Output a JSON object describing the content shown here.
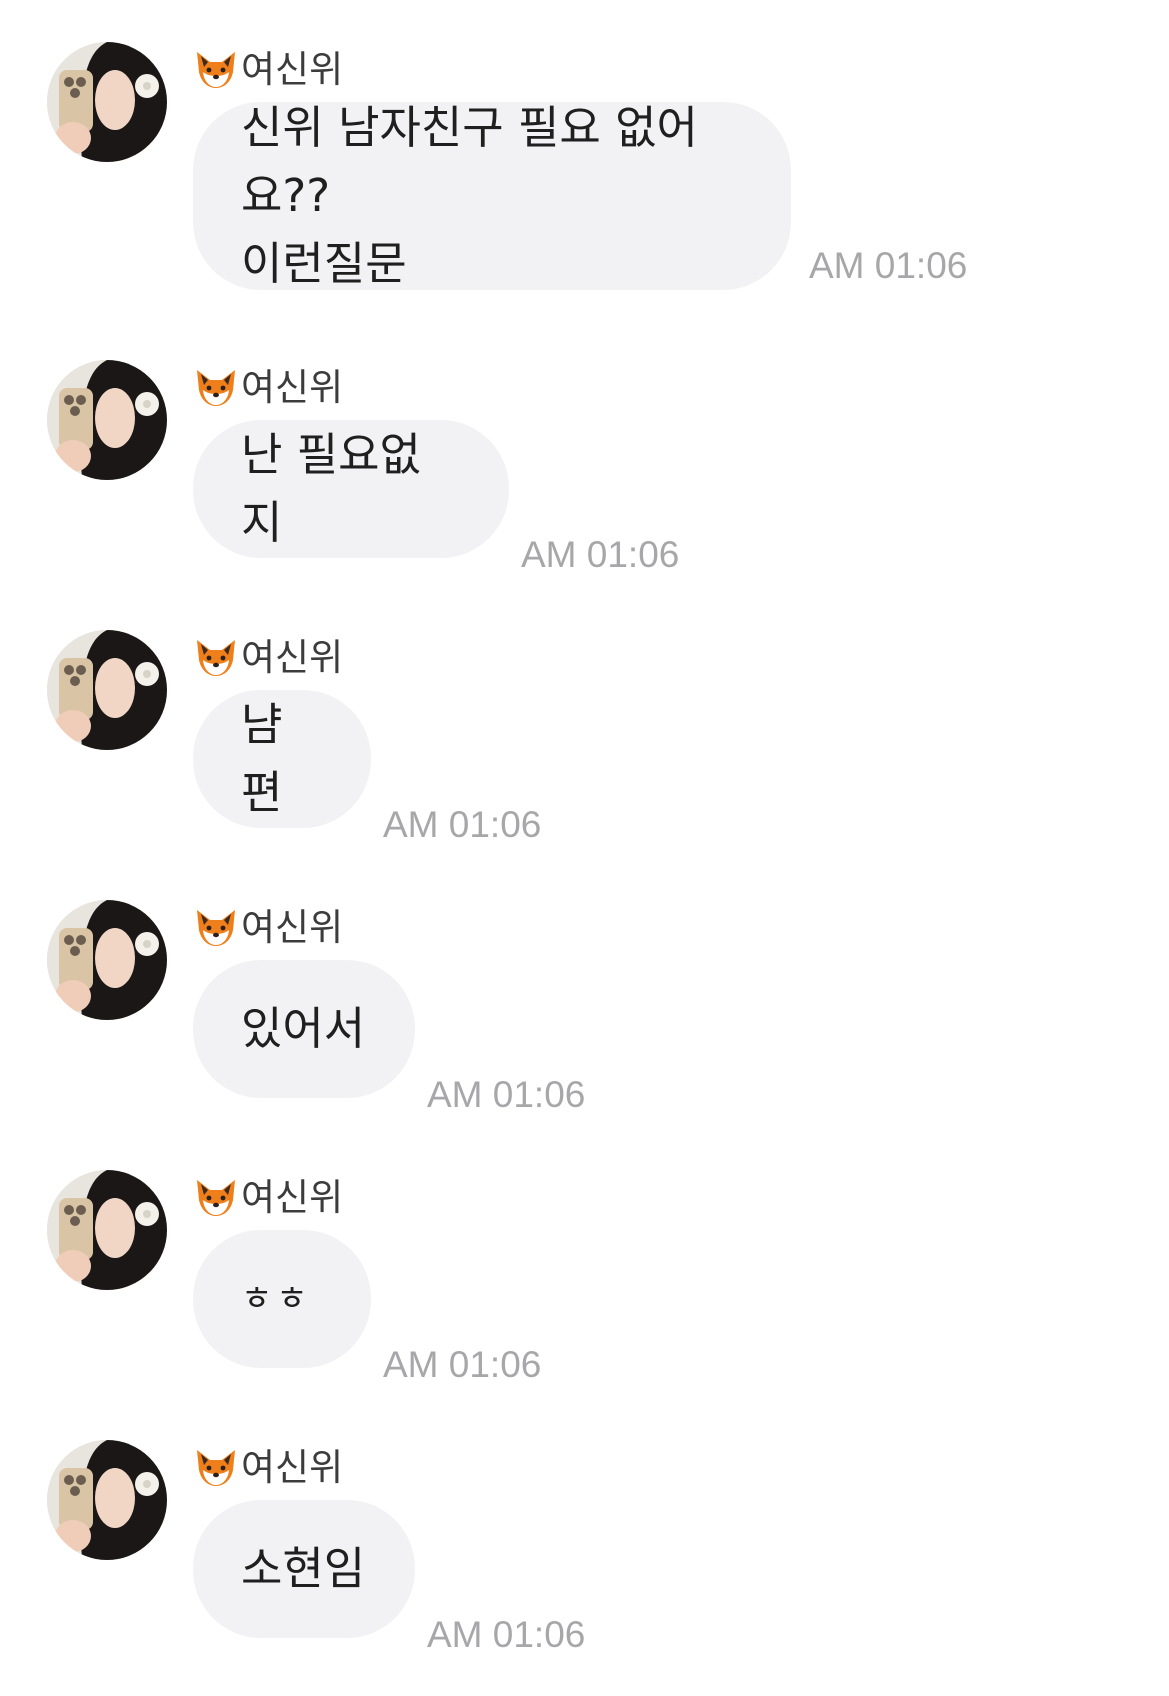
{
  "theme": {
    "bubble_color": "#f2f2f4",
    "text_color": "#1f1f1f",
    "time_color": "#a7a7aa"
  },
  "messages": [
    {
      "sender_icon": "fox-face-icon",
      "sender_name": "여신위",
      "text": "신위 남자친구 필요 없어요??\n이런질문",
      "time": "AM 01:06"
    },
    {
      "sender_icon": "fox-face-icon",
      "sender_name": "여신위",
      "text": "난 필요없지",
      "time": "AM 01:06"
    },
    {
      "sender_icon": "fox-face-icon",
      "sender_name": "여신위",
      "text": "냠편",
      "time": "AM 01:06"
    },
    {
      "sender_icon": "fox-face-icon",
      "sender_name": "여신위",
      "text": "있어서",
      "time": "AM 01:06"
    },
    {
      "sender_icon": "fox-face-icon",
      "sender_name": "여신위",
      "text": "ㅎㅎ",
      "time": "AM 01:06"
    },
    {
      "sender_icon": "fox-face-icon",
      "sender_name": "여신위",
      "text": "소현임",
      "time": "AM 01:06"
    }
  ]
}
